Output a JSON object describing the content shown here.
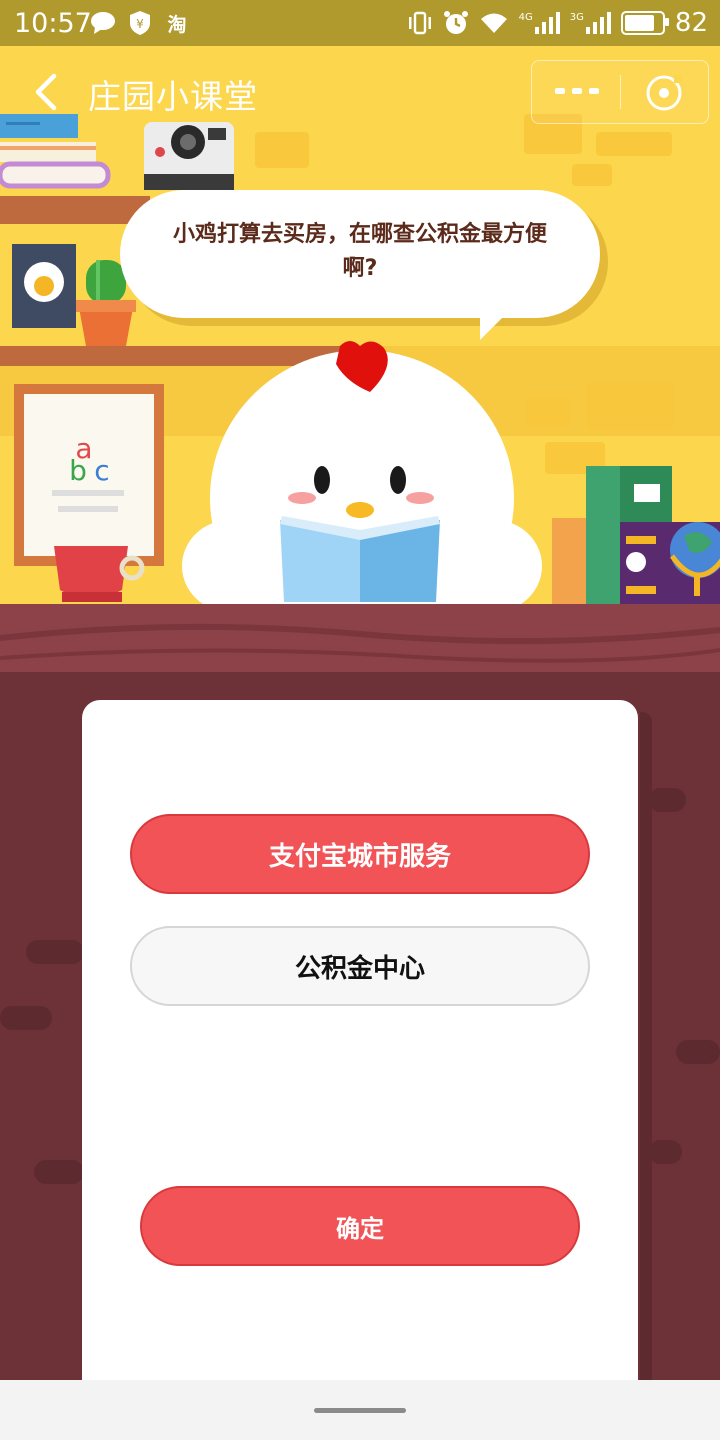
{
  "status_bar": {
    "time": "10:57",
    "left_icons": [
      "chat-bubble-icon",
      "shield-yen-icon",
      "taobao-icon"
    ],
    "right_icons": [
      "vibrate-icon",
      "alarm-icon",
      "wifi-icon",
      "signal-4g-icon",
      "signal-3g-icon",
      "battery-icon"
    ],
    "network_labels": {
      "first": "4G",
      "second": "3G"
    },
    "battery_percent": 82,
    "battery_text": "82"
  },
  "header": {
    "title": "庄园小课堂",
    "back_icon": "chevron-left-icon",
    "more_icon": "more-dots-icon",
    "close_icon": "close-target-icon"
  },
  "question": {
    "text": "小鸡打算去买房，在哪查公积金最方便啊?"
  },
  "options": [
    {
      "label": "支付宝城市服务",
      "selected": true
    },
    {
      "label": "公积金中心",
      "selected": false
    }
  ],
  "confirm_label": "确定",
  "colors": {
    "status_bar": "#b09a2e",
    "scene_bg": "#fcd64c",
    "table": "#8c4248",
    "page_bg": "#6d3238",
    "accent_red": "#f15357",
    "card_bg": "#ffffff"
  }
}
